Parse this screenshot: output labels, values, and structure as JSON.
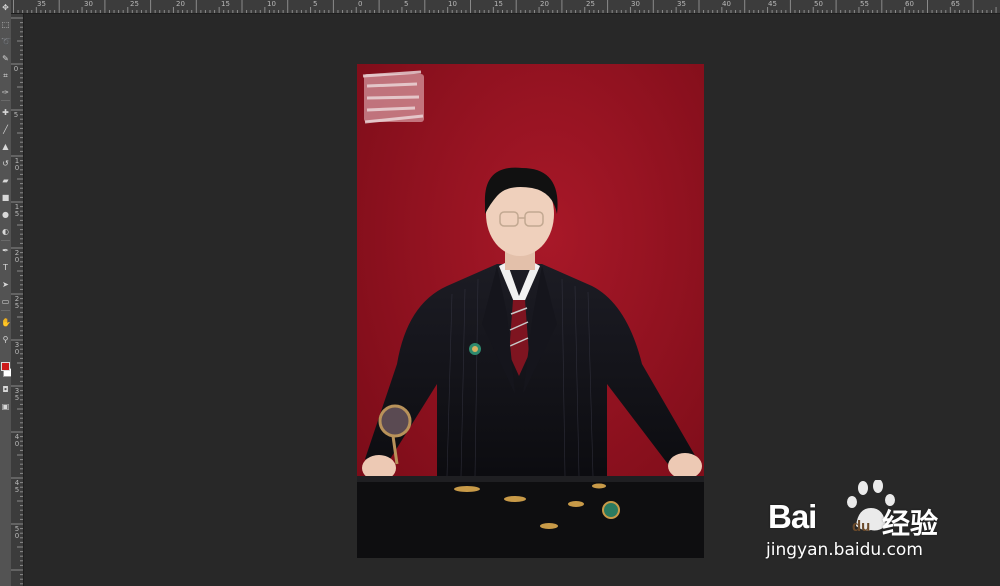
{
  "toolbar": {
    "tools": [
      "move-tool",
      "marquee-tool",
      "lasso-tool",
      "quick-select-tool",
      "crop-tool",
      "eyedropper-tool",
      "healing-brush-tool",
      "brush-tool",
      "clone-stamp-tool",
      "history-brush-tool",
      "eraser-tool",
      "gradient-tool",
      "blur-tool",
      "dodge-tool",
      "pen-tool",
      "type-tool",
      "path-select-tool",
      "rectangle-tool",
      "hand-tool",
      "zoom-tool"
    ],
    "foreground_color": "#cc1a1a",
    "background_color": "#ffffff"
  },
  "ruler_top": {
    "labels": [
      "35",
      "30",
      "25",
      "20",
      "15",
      "10",
      "5",
      "0",
      "5",
      "10",
      "15",
      "20",
      "25",
      "30",
      "35",
      "40",
      "45",
      "50",
      "55",
      "60",
      "65"
    ]
  },
  "ruler_left": {
    "labels": [
      "0",
      "5",
      "1 0",
      "1 5",
      "2 0",
      "2 5",
      "3 0",
      "3 5",
      "4 0",
      "4 5",
      "5 0"
    ]
  },
  "image": {
    "description_alt": "Portrait of a man in a dark suit with glasses at a table, holding a magnifying glass",
    "background_color": "#8c101e"
  },
  "watermark": {
    "brand": "Bai",
    "brand_suffix": "经验",
    "url": "jingyan.baidu.com"
  }
}
